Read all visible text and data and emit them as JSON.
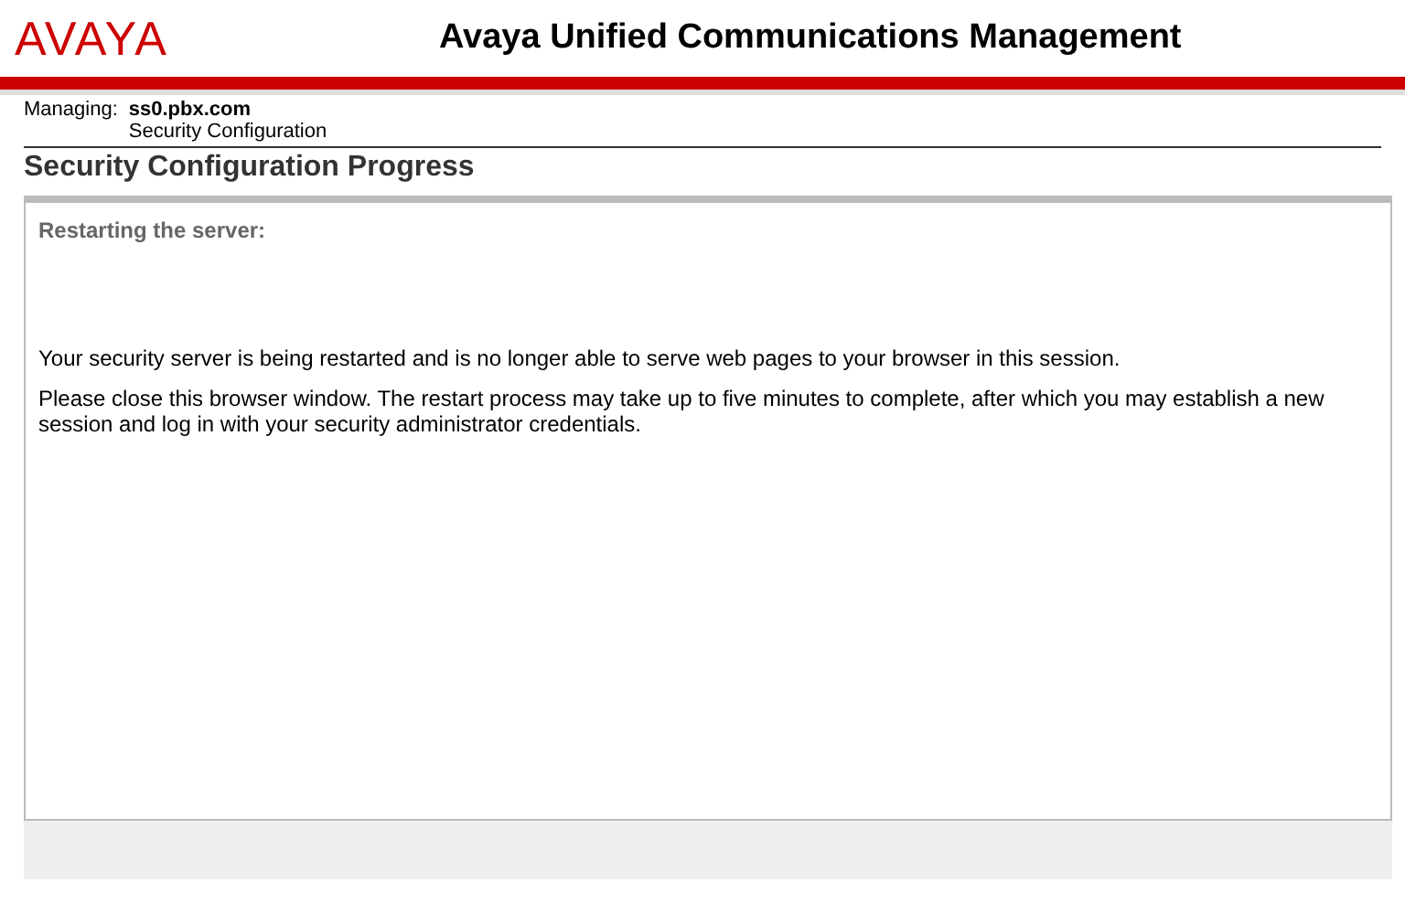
{
  "header": {
    "logo": "AVAYA",
    "title": "Avaya Unified Communications Management"
  },
  "context": {
    "label": "Managing:",
    "host": "ss0.pbx.com",
    "section": "Security Configuration"
  },
  "page_title": "Security Configuration Progress",
  "panel": {
    "heading": "Restarting the server:",
    "paragraphs": [
      "Your security server is being restarted and is no longer able to serve web pages to your browser in this session.",
      "Please close this browser window. The restart process may take up to five minutes to complete, after which you may establish a new session and log in with your security administrator credentials."
    ]
  }
}
